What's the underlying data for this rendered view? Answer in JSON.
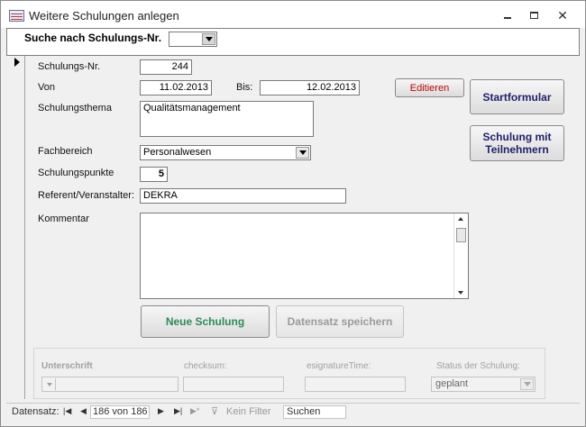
{
  "window": {
    "title": "Weitere Schulungen anlegen"
  },
  "search": {
    "label": "Suche nach Schulungs-Nr.",
    "value": ""
  },
  "form": {
    "schulungs_nr": {
      "label": "Schulungs-Nr.",
      "value": "244"
    },
    "von": {
      "label": "Von",
      "value": "11.02.2013"
    },
    "bis": {
      "label": "Bis:",
      "value": "12.02.2013"
    },
    "schulungsthema": {
      "label": "Schulungsthema",
      "value": "Qualitätsmanagement"
    },
    "fachbereich": {
      "label": "Fachbereich",
      "value": "Personalwesen"
    },
    "schulungspunkte": {
      "label": "Schulungspunkte",
      "value": "5"
    },
    "referent": {
      "label": "Referent/Veranstalter:",
      "value": "DEKRA"
    },
    "kommentar": {
      "label": "Kommentar",
      "value": ""
    }
  },
  "buttons": {
    "editieren": "Editieren",
    "startformular": "Startformular",
    "schulung_mit_teilnehmern": "Schulung mit Teilnehmern",
    "neue_schulung": "Neue Schulung",
    "datensatz_speichern": "Datensatz speichern"
  },
  "signature": {
    "unterschrift_label": "Unterschrift",
    "checksum_label": "checksum:",
    "esignaturetime_label": "esignatureTime:",
    "status_label": "Status der Schulung:",
    "status_value": "geplant"
  },
  "navigation": {
    "label": "Datensatz:",
    "record": "186 von 186",
    "filter": "Kein Filter",
    "search": "Suchen"
  },
  "colors": {
    "editieren_text": "#c00000",
    "neue_schulung_text": "#2e8b57",
    "nav_button_text": "#1f1f6b"
  }
}
